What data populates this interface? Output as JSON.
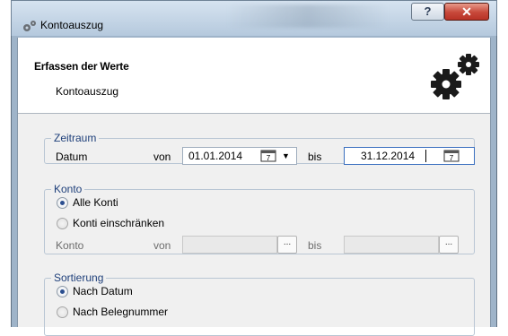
{
  "window": {
    "title": "Kontoauszug",
    "help_label": "?",
    "close_label": "✕"
  },
  "header": {
    "title": "Erfassen der Werte",
    "subtitle": "Kontoauszug"
  },
  "zeitraum": {
    "legend": "Zeitraum",
    "label": "Datum",
    "von_label": "von",
    "von_value": "01.01.2014",
    "bis_label": "bis",
    "bis_value": "31.12.2014"
  },
  "konto": {
    "legend": "Konto",
    "option_all": "Alle Konti",
    "option_restrict": "Konti einschränken",
    "selected": "Alle Konti",
    "label": "Konto",
    "von_label": "von",
    "von_value": "",
    "bis_label": "bis",
    "bis_value": "",
    "browse_label": "..."
  },
  "sortierung": {
    "legend": "Sortierung",
    "option_date": "Nach Datum",
    "option_number": "Nach Belegnummer",
    "selected": "Nach Datum"
  },
  "colors": {
    "legend_text": "#1e3f7a",
    "dialog_background": "#f0f0f0",
    "close_button": "#c7483a"
  },
  "icons": {
    "title": "gears-icon",
    "header": "gears-icon",
    "calendar": "calendar-icon",
    "dropdown": "chevron-down-icon"
  }
}
